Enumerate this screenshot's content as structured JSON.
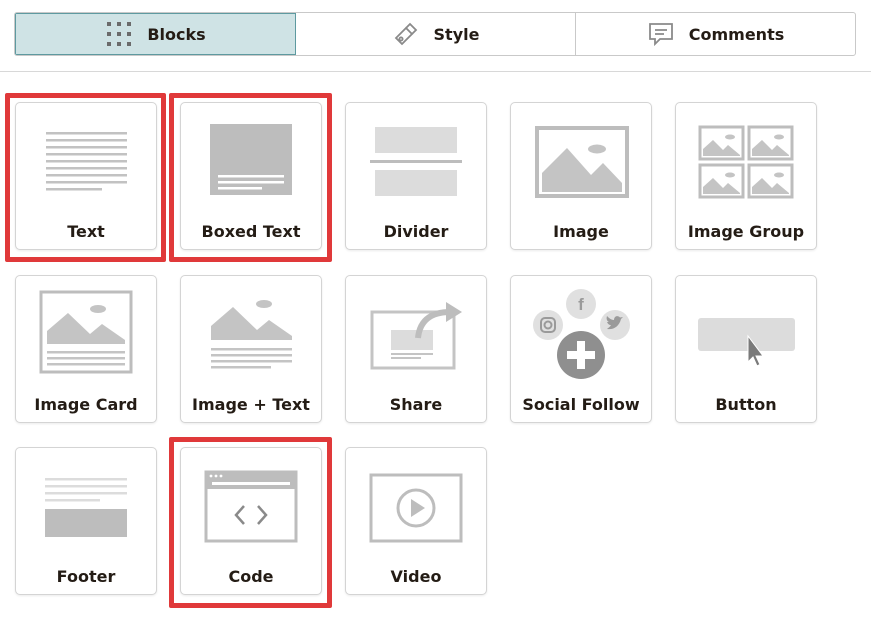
{
  "tabs": [
    {
      "label": "Blocks",
      "icon": "grid-icon",
      "active": true
    },
    {
      "label": "Style",
      "icon": "paint-brush-icon",
      "active": false
    },
    {
      "label": "Comments",
      "icon": "comment-icon",
      "active": false
    }
  ],
  "blocks": [
    {
      "label": "Text",
      "icon": "text-block-icon",
      "highlighted": true
    },
    {
      "label": "Boxed Text",
      "icon": "boxed-text-block-icon",
      "highlighted": true
    },
    {
      "label": "Divider",
      "icon": "divider-block-icon",
      "highlighted": false
    },
    {
      "label": "Image",
      "icon": "image-block-icon",
      "highlighted": false
    },
    {
      "label": "Image Group",
      "icon": "image-group-block-icon",
      "highlighted": false
    },
    {
      "label": "Image Card",
      "icon": "image-card-block-icon",
      "highlighted": false
    },
    {
      "label": "Image + Text",
      "icon": "image-text-block-icon",
      "highlighted": false
    },
    {
      "label": "Share",
      "icon": "share-block-icon",
      "highlighted": false
    },
    {
      "label": "Social Follow",
      "icon": "social-follow-block-icon",
      "highlighted": false
    },
    {
      "label": "Button",
      "icon": "button-block-icon",
      "highlighted": false
    },
    {
      "label": "Footer",
      "icon": "footer-block-icon",
      "highlighted": false
    },
    {
      "label": "Code",
      "icon": "code-block-icon",
      "highlighted": true
    },
    {
      "label": "Video",
      "icon": "video-block-icon",
      "highlighted": false
    }
  ],
  "colors": {
    "highlight": "#e0393a",
    "active_tab_bg": "#cfe3e5",
    "icon_gray": "#bdbdbd"
  }
}
